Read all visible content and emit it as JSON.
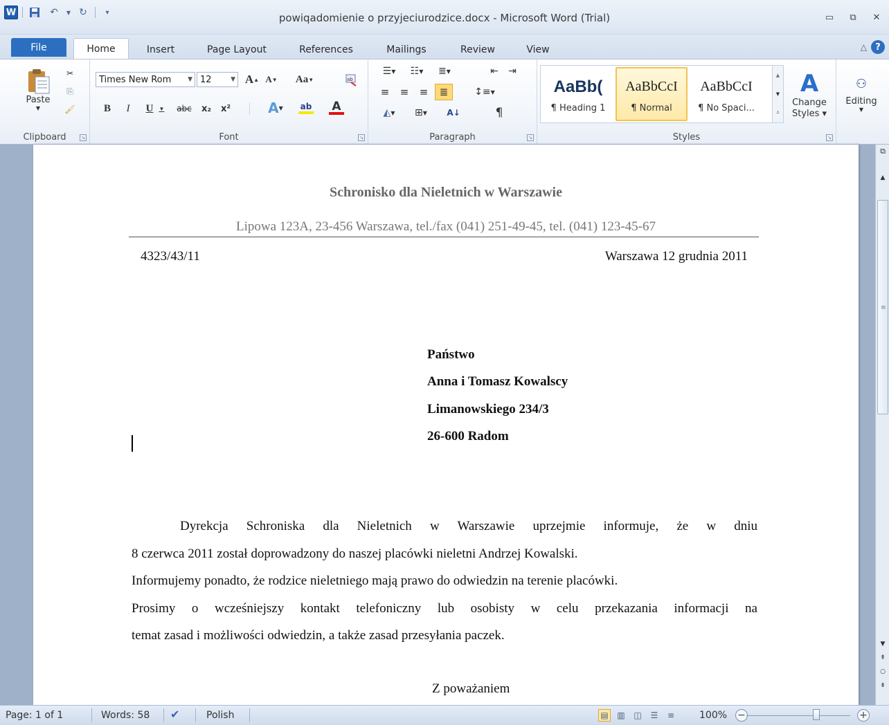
{
  "window": {
    "title": "powiqadomienie o przyjeciurodzice.docx - Microsoft Word (Trial)",
    "logo_letter": "W"
  },
  "tabs": [
    "File",
    "Home",
    "Insert",
    "Page Layout",
    "References",
    "Mailings",
    "Review",
    "View"
  ],
  "active_tab": "Home",
  "ribbon": {
    "clipboard": {
      "label": "Clipboard",
      "paste_label": "Paste"
    },
    "font": {
      "label": "Font",
      "font_name": "Times New Rom",
      "font_size": "12",
      "bold": "B",
      "italic": "I",
      "underline": "U",
      "strike": "abc",
      "subscript": "x₂",
      "superscript": "x²",
      "grow": "A",
      "shrink": "A",
      "change_case": "Aa"
    },
    "paragraph": {
      "label": "Paragraph",
      "pilcrow": "¶"
    },
    "styles": {
      "label": "Styles",
      "items": [
        {
          "preview": "AaBb(",
          "name": "¶ Heading 1"
        },
        {
          "preview": "AaBbCcI",
          "name": "¶ Normal"
        },
        {
          "preview": "AaBbCcI",
          "name": "¶ No Spaci..."
        }
      ],
      "change_styles": "Change Styles ▾"
    },
    "editing": {
      "label": "Editing"
    }
  },
  "document": {
    "header_title": "Schronisko dla Nieletnich w Warszawie",
    "header_address": "Lipowa 123A, 23-456 Warszawa, tel./fax (041) 251-49-45, tel. (041) 123-45-67",
    "reference_number": "4323/43/11",
    "place_date": "Warszawa 12 grudnia 2011",
    "recipient": [
      "Państwo",
      "Anna i Tomasz Kowalscy",
      "Limanowskiego 234/3",
      "26-600 Radom"
    ],
    "body_lines": [
      "Dyrekcja Schroniska dla Nieletnich w Warszawie uprzejmie informuje, że w dniu",
      "8 czerwca 2011 został doprowadzony do naszej placówki nieletni Andrzej Kowalski.",
      "Informujemy ponadto, że rodzice nieletniego mają prawo do odwiedzin na terenie placówki.",
      "Prosimy o wcześniejszy kontakt telefoniczny lub osobisty w celu przekazania informacji na",
      "temat zasad i możliwości odwiedzin, a także zasad przesyłania paczek."
    ],
    "closing": "Z poważaniem"
  },
  "status_bar": {
    "page": "Page: 1 of 1",
    "words": "Words: 58",
    "language": "Polish",
    "zoom": "100%",
    "zoom_level_percent": 100
  },
  "colors": {
    "accent": "#2c6fc1",
    "selected_style": "#ffe9a8",
    "font_color_bar": "#e01010",
    "highlight_bar": "#f5e900"
  }
}
